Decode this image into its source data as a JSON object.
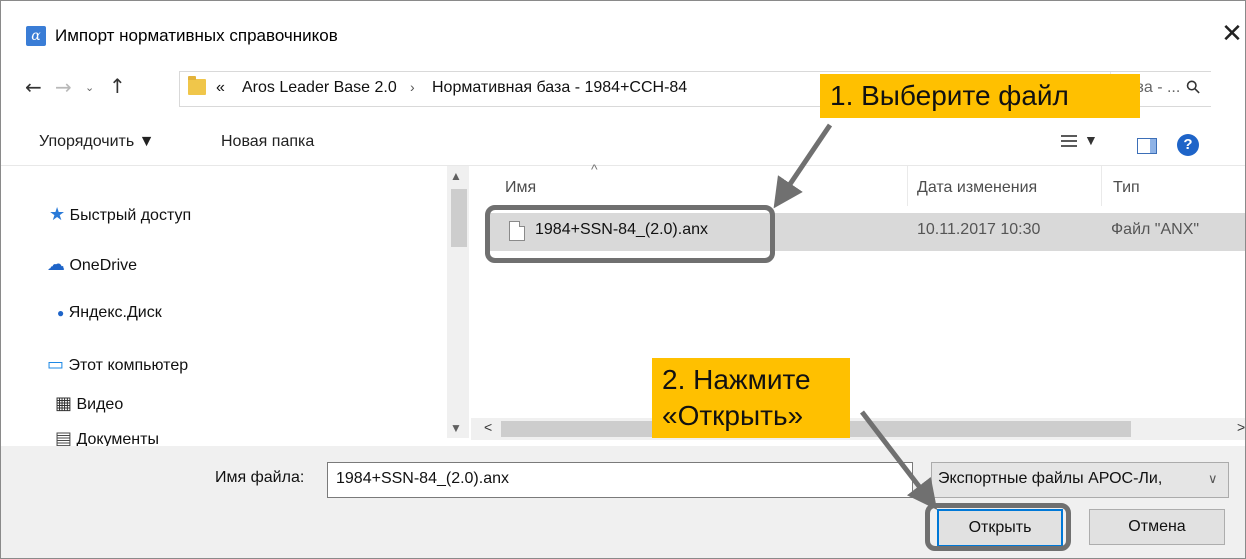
{
  "window": {
    "title": "Импорт нормативных справочников",
    "app_icon_glyph": "α",
    "close_glyph": "✕"
  },
  "address_bar": {
    "overflow": "«",
    "path": [
      "Aros Leader Base 2.0",
      "Нормативная база - 1984+ССН-84"
    ],
    "separator": "›",
    "search_placeholder": "база - ...",
    "nav_back": "←",
    "nav_forward": "→",
    "nav_recent": "⌄",
    "nav_up": "↑",
    "search_glyph": "⚲"
  },
  "toolbar": {
    "organize": "Упорядочить ▼",
    "new_folder": "Новая папка",
    "view_caret": "▼",
    "help": "?"
  },
  "nav_pane": {
    "items": [
      {
        "label": "Быстрый доступ",
        "icon": "star-icon",
        "glyph": "★",
        "color": "#2a7ad8"
      },
      {
        "label": "OneDrive",
        "icon": "cloud-icon",
        "glyph": "☁",
        "color": "#1e64c8"
      },
      {
        "label": "Яндекс.Диск",
        "icon": "yandex-disk-icon",
        "glyph": "●",
        "color": "#1e64c8"
      },
      {
        "label": "Этот компьютер",
        "icon": "computer-icon",
        "glyph": "▭",
        "color": "#1e88e5"
      },
      {
        "label": "Видео",
        "icon": "video-icon",
        "glyph": "▦",
        "color": "#333333"
      },
      {
        "label": "Документы",
        "icon": "documents-icon",
        "glyph": "▤",
        "color": "#4a4a4a"
      }
    ]
  },
  "file_list": {
    "columns": [
      "Имя",
      "Дата изменения",
      "Тип"
    ],
    "sort_glyph": "^",
    "rows": [
      {
        "name": "1984+SSN-84_(2.0).anx",
        "date": "10.11.2017 10:30",
        "type": "Файл \"ANX\""
      }
    ]
  },
  "footer": {
    "filename_label": "Имя файла:",
    "filename_value": "1984+SSN-84_(2.0).anx",
    "filter_value": "Экспортные файлы АРОС-Ли,",
    "open_button": "Открыть",
    "cancel_button": "Отмена",
    "dropdown_glyph": "∨"
  },
  "annotations": {
    "step1": "1. Выберите файл",
    "step2": "2. Нажмите «Открыть»",
    "highlight_color": "#ffc000",
    "frame_color": "#707070"
  }
}
